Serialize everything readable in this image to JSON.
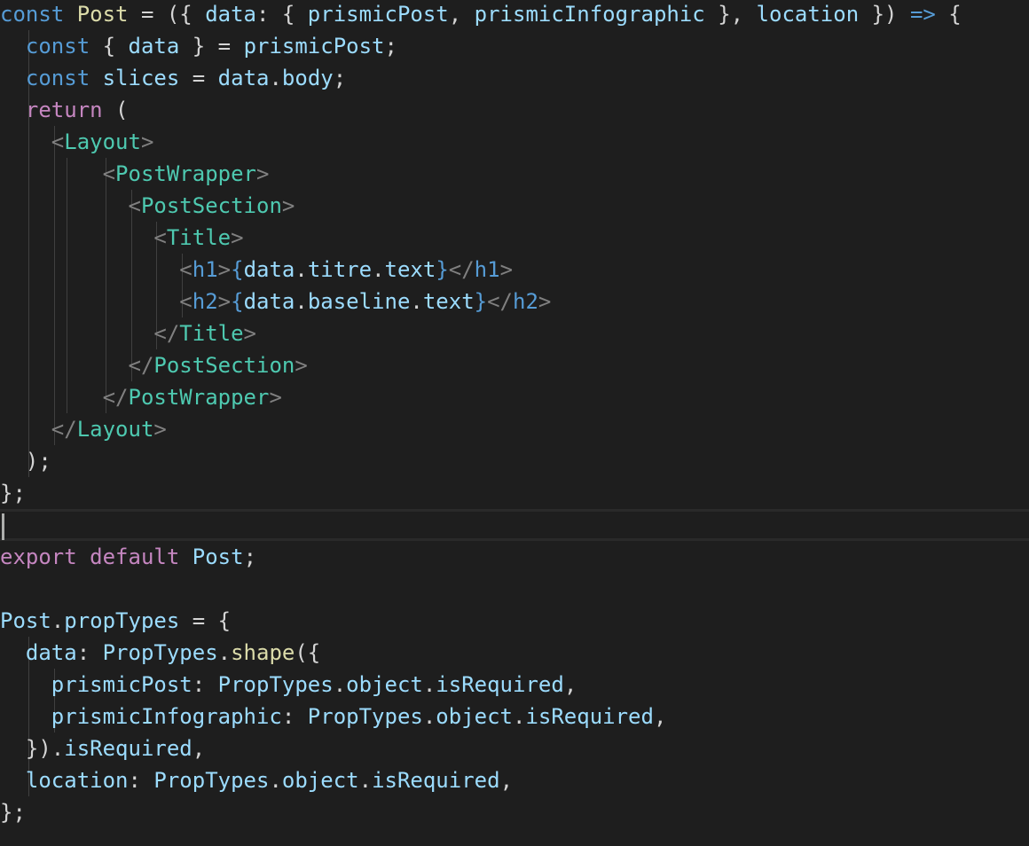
{
  "editor": {
    "language": "javascript-jsx",
    "theme_colors": {
      "background": "#1e1e1e",
      "keyword": "#569cd6",
      "control": "#c586c0",
      "variable": "#9cdcfe",
      "function": "#dcdcaa",
      "component": "#4ec9b0",
      "text": "#d4d4d4",
      "angle": "#808080"
    },
    "lines": [
      [
        [
          "k-blue",
          "const "
        ],
        [
          "k-fn",
          "Post"
        ],
        [
          "k-punc",
          " = ({ "
        ],
        [
          "k-var",
          "data"
        ],
        [
          "k-punc",
          ": { "
        ],
        [
          "k-var",
          "prismicPost"
        ],
        [
          "k-punc",
          ", "
        ],
        [
          "k-var",
          "prismicInfographic"
        ],
        [
          "k-punc",
          " }, "
        ],
        [
          "k-var",
          "location"
        ],
        [
          "k-punc",
          " }) "
        ],
        [
          "k-blue",
          "=>"
        ],
        [
          "k-punc",
          " {"
        ]
      ],
      [
        [
          "k-punc",
          "  "
        ],
        [
          "k-blue",
          "const"
        ],
        [
          "k-punc",
          " { "
        ],
        [
          "k-var",
          "data"
        ],
        [
          "k-punc",
          " } = "
        ],
        [
          "k-var",
          "prismicPost"
        ],
        [
          "k-punc",
          ";"
        ]
      ],
      [
        [
          "k-punc",
          "  "
        ],
        [
          "k-blue",
          "const "
        ],
        [
          "k-var",
          "slices"
        ],
        [
          "k-punc",
          " = "
        ],
        [
          "k-var",
          "data"
        ],
        [
          "k-punc",
          "."
        ],
        [
          "k-var",
          "body"
        ],
        [
          "k-punc",
          ";"
        ]
      ],
      [
        [
          "k-punc",
          "  "
        ],
        [
          "k-purple",
          "return"
        ],
        [
          "k-punc",
          " ("
        ]
      ],
      [
        [
          "k-punc",
          "    "
        ],
        [
          "k-ang",
          "<"
        ],
        [
          "k-tag",
          "Layout"
        ],
        [
          "k-ang",
          ">"
        ]
      ],
      [
        [
          "k-punc",
          "        "
        ],
        [
          "k-ang",
          "<"
        ],
        [
          "k-tag",
          "PostWrapper"
        ],
        [
          "k-ang",
          ">"
        ]
      ],
      [
        [
          "k-punc",
          "          "
        ],
        [
          "k-ang",
          "<"
        ],
        [
          "k-tag",
          "PostSection"
        ],
        [
          "k-ang",
          ">"
        ]
      ],
      [
        [
          "k-punc",
          "            "
        ],
        [
          "k-ang",
          "<"
        ],
        [
          "k-tag",
          "Title"
        ],
        [
          "k-ang",
          ">"
        ]
      ],
      [
        [
          "k-punc",
          "              "
        ],
        [
          "k-ang",
          "<"
        ],
        [
          "k-html",
          "h1"
        ],
        [
          "k-ang",
          ">"
        ],
        [
          "k-blue",
          "{"
        ],
        [
          "k-var",
          "data"
        ],
        [
          "k-punc",
          "."
        ],
        [
          "k-var",
          "titre"
        ],
        [
          "k-punc",
          "."
        ],
        [
          "k-var",
          "text"
        ],
        [
          "k-blue",
          "}"
        ],
        [
          "k-ang",
          "</"
        ],
        [
          "k-html",
          "h1"
        ],
        [
          "k-ang",
          ">"
        ]
      ],
      [
        [
          "k-punc",
          "              "
        ],
        [
          "k-ang",
          "<"
        ],
        [
          "k-html",
          "h2"
        ],
        [
          "k-ang",
          ">"
        ],
        [
          "k-blue",
          "{"
        ],
        [
          "k-var",
          "data"
        ],
        [
          "k-punc",
          "."
        ],
        [
          "k-var",
          "baseline"
        ],
        [
          "k-punc",
          "."
        ],
        [
          "k-var",
          "text"
        ],
        [
          "k-blue",
          "}"
        ],
        [
          "k-ang",
          "</"
        ],
        [
          "k-html",
          "h2"
        ],
        [
          "k-ang",
          ">"
        ]
      ],
      [
        [
          "k-punc",
          "            "
        ],
        [
          "k-ang",
          "</"
        ],
        [
          "k-tag",
          "Title"
        ],
        [
          "k-ang",
          ">"
        ]
      ],
      [
        [
          "k-punc",
          "          "
        ],
        [
          "k-ang",
          "</"
        ],
        [
          "k-tag",
          "PostSection"
        ],
        [
          "k-ang",
          ">"
        ]
      ],
      [
        [
          "k-punc",
          "        "
        ],
        [
          "k-ang",
          "</"
        ],
        [
          "k-tag",
          "PostWrapper"
        ],
        [
          "k-ang",
          ">"
        ]
      ],
      [
        [
          "k-punc",
          "    "
        ],
        [
          "k-ang",
          "</"
        ],
        [
          "k-tag",
          "Layout"
        ],
        [
          "k-ang",
          ">"
        ]
      ],
      [
        [
          "k-punc",
          "  );"
        ]
      ],
      [
        [
          "k-punc",
          "};"
        ]
      ],
      [],
      [
        [
          "k-purple",
          "export"
        ],
        [
          "k-punc",
          " "
        ],
        [
          "k-purple",
          "default"
        ],
        [
          "k-punc",
          " "
        ],
        [
          "k-var",
          "Post"
        ],
        [
          "k-punc",
          ";"
        ]
      ],
      [],
      [
        [
          "k-var",
          "Post"
        ],
        [
          "k-punc",
          "."
        ],
        [
          "k-var",
          "propTypes"
        ],
        [
          "k-punc",
          " = {"
        ]
      ],
      [
        [
          "k-punc",
          "  "
        ],
        [
          "k-var",
          "data"
        ],
        [
          "k-punc",
          ": "
        ],
        [
          "k-var",
          "PropTypes"
        ],
        [
          "k-punc",
          "."
        ],
        [
          "k-fn",
          "shape"
        ],
        [
          "k-punc",
          "({"
        ]
      ],
      [
        [
          "k-punc",
          "    "
        ],
        [
          "k-var",
          "prismicPost"
        ],
        [
          "k-punc",
          ": "
        ],
        [
          "k-var",
          "PropTypes"
        ],
        [
          "k-punc",
          "."
        ],
        [
          "k-var",
          "object"
        ],
        [
          "k-punc",
          "."
        ],
        [
          "k-var",
          "isRequired"
        ],
        [
          "k-punc",
          ","
        ]
      ],
      [
        [
          "k-punc",
          "    "
        ],
        [
          "k-var",
          "prismicInfographic"
        ],
        [
          "k-punc",
          ": "
        ],
        [
          "k-var",
          "PropTypes"
        ],
        [
          "k-punc",
          "."
        ],
        [
          "k-var",
          "object"
        ],
        [
          "k-punc",
          "."
        ],
        [
          "k-var",
          "isRequired"
        ],
        [
          "k-punc",
          ","
        ]
      ],
      [
        [
          "k-punc",
          "  })."
        ],
        [
          "k-var",
          "isRequired"
        ],
        [
          "k-punc",
          ","
        ]
      ],
      [
        [
          "k-punc",
          "  "
        ],
        [
          "k-var",
          "location"
        ],
        [
          "k-punc",
          ": "
        ],
        [
          "k-var",
          "PropTypes"
        ],
        [
          "k-punc",
          "."
        ],
        [
          "k-var",
          "object"
        ],
        [
          "k-punc",
          "."
        ],
        [
          "k-var",
          "isRequired"
        ],
        [
          "k-punc",
          ","
        ]
      ],
      [
        [
          "k-punc",
          "};"
        ]
      ]
    ]
  }
}
